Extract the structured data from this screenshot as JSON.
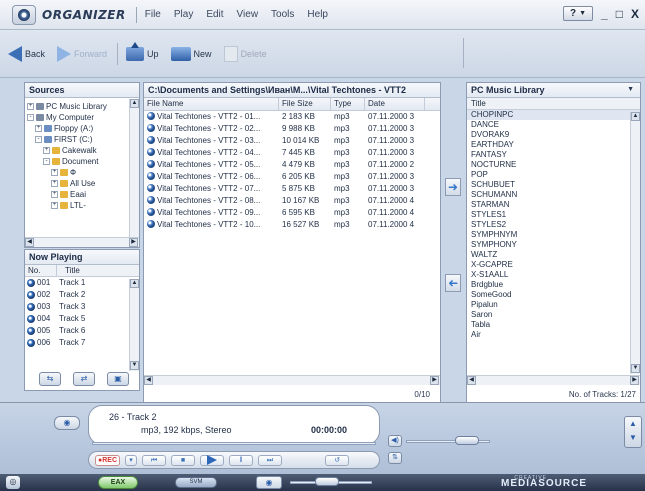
{
  "app": {
    "title": "ORGANIZER"
  },
  "menu": [
    "File",
    "Play",
    "Edit",
    "View",
    "Tools",
    "Help"
  ],
  "window": {
    "help": "?",
    "minimize": "_",
    "maximize": "□",
    "close": "X"
  },
  "toolbar": {
    "back": "Back",
    "forward": "Forward",
    "up": "Up",
    "new": "New",
    "delete": "Delete"
  },
  "sources": {
    "title": "Sources",
    "tree": [
      {
        "label": "PC Music Library",
        "indent": 0,
        "icon": "pc",
        "expander": "+"
      },
      {
        "label": "My Computer",
        "indent": 0,
        "icon": "pc",
        "expander": "-"
      },
      {
        "label": "Floppy (A:)",
        "indent": 1,
        "icon": "drive",
        "expander": "+"
      },
      {
        "label": "FIRST (C:)",
        "indent": 1,
        "icon": "drive",
        "expander": "-"
      },
      {
        "label": "Cakewalk",
        "indent": 2,
        "icon": "folder",
        "expander": "+"
      },
      {
        "label": "Document",
        "indent": 2,
        "icon": "folder",
        "expander": "-"
      },
      {
        "label": "Ф",
        "indent": 3,
        "icon": "folder",
        "expander": "+"
      },
      {
        "label": "All Use",
        "indent": 3,
        "icon": "folder",
        "expander": "+"
      },
      {
        "label": "Eaai",
        "indent": 3,
        "icon": "folder",
        "expander": "+"
      },
      {
        "label": "LTL-",
        "indent": 3,
        "icon": "folder",
        "expander": "+"
      }
    ]
  },
  "now_playing": {
    "title": "Now Playing",
    "columns": [
      "No.",
      "Title"
    ],
    "rows": [
      {
        "no": "001",
        "title": "Track 1"
      },
      {
        "no": "002",
        "title": "Track 2"
      },
      {
        "no": "003",
        "title": "Track 3"
      },
      {
        "no": "004",
        "title": "Track 5"
      },
      {
        "no": "005",
        "title": "Track 6"
      },
      {
        "no": "006",
        "title": "Track 7"
      }
    ]
  },
  "files": {
    "path": "C:\\Documents and Settings\\Иван\\M...\\Vital Techtones - VTT2",
    "columns": [
      "File Name",
      "File Size",
      "Type",
      "Date"
    ],
    "rows": [
      {
        "name": "Vital Techtones - VTT2 - 01...",
        "size": "2 183 KB",
        "type": "mp3",
        "date": "07.11.2000 3"
      },
      {
        "name": "Vital Techtones - VTT2 - 02...",
        "size": "9 988 KB",
        "type": "mp3",
        "date": "07.11.2000 3"
      },
      {
        "name": "Vital Techtones - VTT2 - 03...",
        "size": "10 014 KB",
        "type": "mp3",
        "date": "07.11.2000 3"
      },
      {
        "name": "Vital Techtones - VTT2 - 04...",
        "size": "7 445 KB",
        "type": "mp3",
        "date": "07.11.2000 3"
      },
      {
        "name": "Vital Techtones - VTT2 - 05...",
        "size": "4 479 KB",
        "type": "mp3",
        "date": "07.11.2000 2"
      },
      {
        "name": "Vital Techtones - VTT2 - 06...",
        "size": "6 205 KB",
        "type": "mp3",
        "date": "07.11.2000 3"
      },
      {
        "name": "Vital Techtones - VTT2 - 07...",
        "size": "5 875 KB",
        "type": "mp3",
        "date": "07.11.2000 3"
      },
      {
        "name": "Vital Techtones - VTT2 - 08...",
        "size": "10 167 KB",
        "type": "mp3",
        "date": "07.11.2000 4"
      },
      {
        "name": "Vital Techtones - VTT2 - 09...",
        "size": "6 595 KB",
        "type": "mp3",
        "date": "07.11.2000 4"
      },
      {
        "name": "Vital Techtones - VTT2 - 10...",
        "size": "16 527 KB",
        "type": "mp3",
        "date": "07.11.2000 4"
      }
    ],
    "status": "0/10"
  },
  "library": {
    "title": "PC Music Library",
    "column": "Title",
    "items": [
      "CHOPINPC",
      "DANCE",
      "DVORAK9",
      "EARTHDAY",
      "FANTASY",
      "NOCTURNE",
      "POP",
      "SCHUBUET",
      "SCHUMANN",
      "STARMAN",
      "STYLES1",
      "STYLES2",
      "SYMPHNYM",
      "SYMPHONY",
      "WALTZ",
      "X-GCAPRE",
      "X-S1AALL",
      "Brdgblue",
      "SomeGood",
      "Pipalun",
      "Saron",
      "Tabla",
      "Air"
    ],
    "status": "No. of Tracks: 1/27"
  },
  "player": {
    "track_no": "26",
    "track_name": "Track 2",
    "format": "mp3, 192 kbps, Stereo",
    "time": "00:00:00",
    "rec": "REC",
    "eax": "EAX",
    "svm": "SVM",
    "brand": "MEDIASOURCE",
    "brand_small": "CREATIVE"
  }
}
